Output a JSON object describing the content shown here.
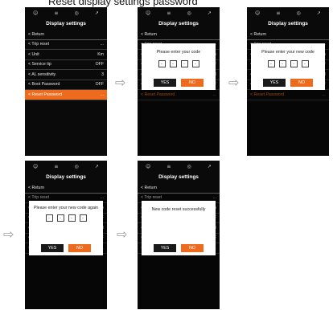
{
  "caption": "Reset display settings password",
  "status_icons": [
    "☺",
    "≡",
    "◎",
    "↗"
  ],
  "screen_title": "Display settings",
  "return_label": "Return",
  "menu": [
    {
      "label": "Trip reset",
      "value": "..."
    },
    {
      "label": "Unit",
      "value": "Km"
    },
    {
      "label": "Service tip",
      "value": "OFF"
    },
    {
      "label": "AL sensitivity",
      "value": "3"
    },
    {
      "label": "Boot Password",
      "value": "OFF"
    },
    {
      "label": "Reset Password",
      "value": "..."
    }
  ],
  "dialogs": {
    "enter_code": "Please enter your code",
    "enter_new": "Please enter your new code",
    "enter_again": "Please enter your new code again",
    "success": "New code reset successfully"
  },
  "code_placeholder": "-",
  "yes_label": "YES",
  "no_label": "NO",
  "arrow_glyph": "⇨"
}
